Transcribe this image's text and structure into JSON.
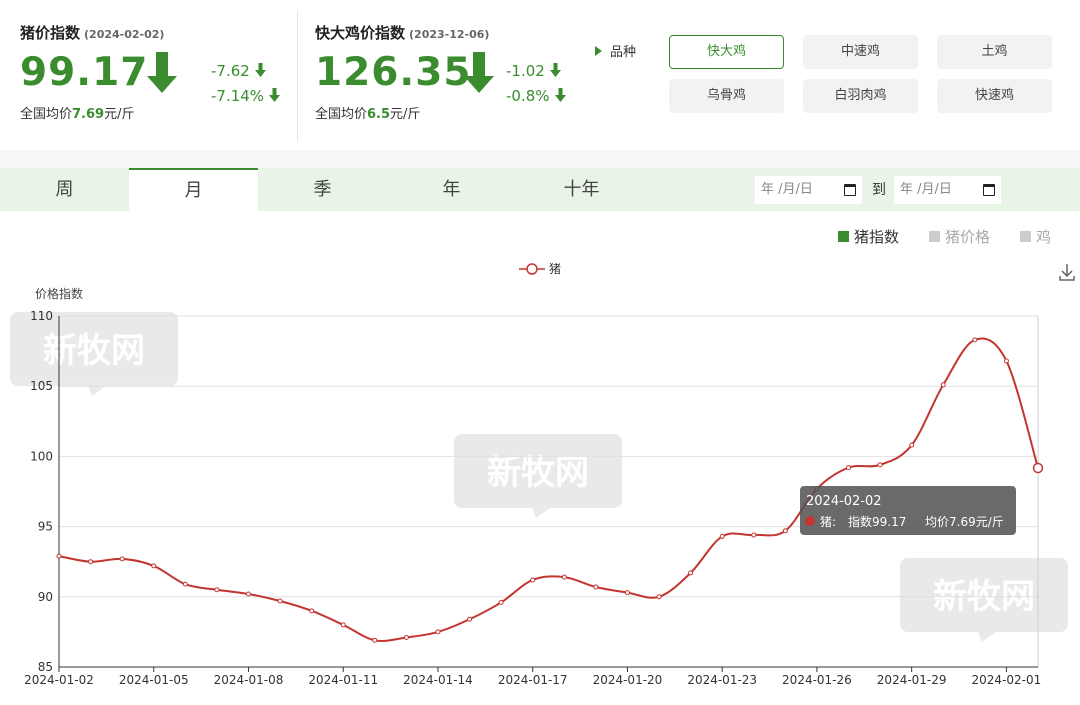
{
  "pig_index": {
    "title": "猪价指数",
    "date": "(2024-02-02)",
    "value": "99.17",
    "change_abs": "-7.62",
    "change_pct": "-7.14%",
    "avg_prefix": "全国均价",
    "avg_value": "7.69",
    "avg_unit": "元/斤"
  },
  "chicken_index": {
    "title": "快大鸡价指数",
    "date": "(2023-12-06)",
    "value": "126.35",
    "change_abs": "-1.02",
    "change_pct": "-0.8%",
    "avg_prefix": "全国均价",
    "avg_value": "6.5",
    "avg_unit": "元/斤"
  },
  "variety": {
    "label": "品种",
    "options": [
      "快大鸡",
      "中速鸡",
      "土鸡",
      "乌骨鸡",
      "白羽肉鸡",
      "快速鸡"
    ],
    "selected": "快大鸡"
  },
  "tabs": [
    "周",
    "月",
    "季",
    "年",
    "十年"
  ],
  "active_tab": "月",
  "date_range": {
    "start_placeholder": "年 /月/日",
    "to_label": "到",
    "end_placeholder": "年 /月/日"
  },
  "metrics": [
    {
      "label": "猪指数",
      "active": true
    },
    {
      "label": "猪价格",
      "active": false
    },
    {
      "label": "鸡",
      "active": false
    }
  ],
  "watermark": "新牧网",
  "colors": {
    "accent": "#3a8c2f",
    "line": "#c23531",
    "inactive": "#cccccc"
  },
  "icons": {
    "down_arrow": "down-arrow-icon",
    "download": "download-icon",
    "calendar": "calendar-icon",
    "play": "play-icon"
  },
  "chart_data": {
    "type": "line",
    "legend": "猪",
    "ylabel": "价格指数",
    "ylim": [
      85,
      110
    ],
    "yticks": [
      85,
      90,
      95,
      100,
      105,
      110
    ],
    "x_tick_labels": [
      "2024-01-02",
      "2024-01-05",
      "2024-01-08",
      "2024-01-11",
      "2024-01-14",
      "2024-01-17",
      "2024-01-20",
      "2024-01-23",
      "2024-01-26",
      "2024-01-29",
      "2024-02-01"
    ],
    "x": [
      "2024-01-02",
      "2024-01-03",
      "2024-01-04",
      "2024-01-05",
      "2024-01-06",
      "2024-01-07",
      "2024-01-08",
      "2024-01-09",
      "2024-01-10",
      "2024-01-11",
      "2024-01-12",
      "2024-01-13",
      "2024-01-14",
      "2024-01-15",
      "2024-01-16",
      "2024-01-17",
      "2024-01-18",
      "2024-01-19",
      "2024-01-20",
      "2024-01-21",
      "2024-01-22",
      "2024-01-23",
      "2024-01-24",
      "2024-01-25",
      "2024-01-26",
      "2024-01-27",
      "2024-01-28",
      "2024-01-29",
      "2024-01-30",
      "2024-01-31",
      "2024-02-01",
      "2024-02-02"
    ],
    "series": [
      {
        "name": "猪",
        "values": [
          92.9,
          92.5,
          92.7,
          92.2,
          90.9,
          90.5,
          90.2,
          89.7,
          89.0,
          88.0,
          86.9,
          87.1,
          87.5,
          88.4,
          89.6,
          91.2,
          91.4,
          90.7,
          90.3,
          90.0,
          91.7,
          94.3,
          94.4,
          94.7,
          97.7,
          99.2,
          99.4,
          100.8,
          105.1,
          108.3,
          106.8,
          99.17
        ]
      }
    ],
    "tooltip": {
      "date": "2024-02-02",
      "series": "猪:",
      "index_text": "指数99.17",
      "price_text": "均价7.69元/斤"
    }
  }
}
